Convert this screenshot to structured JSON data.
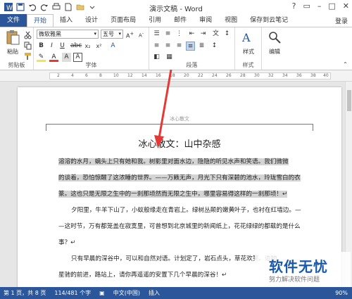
{
  "window": {
    "title": "演示文稿 - Word",
    "controls": [
      "?",
      "▭",
      "–",
      "□",
      "✕"
    ]
  },
  "tabs": {
    "file": "文件",
    "items": [
      "开始",
      "插入",
      "设计",
      "页面布局",
      "引用",
      "邮件",
      "审阅",
      "视图",
      "保存到云笔记"
    ],
    "login": "登录"
  },
  "ribbon": {
    "paste": "粘贴",
    "clipboard_label": "剪贴板",
    "font_name": "微软雅黑",
    "font_size": "五号",
    "font_label": "字体",
    "paragraph_label": "段落",
    "styles": "样式",
    "styles_label": "样式",
    "edit": "编辑"
  },
  "ruler": {
    "numbers": [
      "2",
      "4",
      "6",
      "8",
      "10",
      "12",
      "14",
      "16",
      "18",
      "20",
      "22",
      "24",
      "26",
      "28",
      "30",
      "32",
      "34",
      "36",
      "38",
      "40"
    ]
  },
  "document": {
    "header": "冰心散文",
    "title": "冰心散文：山中杂感",
    "paragraphs": [
      {
        "lines": [
          "溶溶的水月，螭头上只有她和我。树影里对面水边，隐隐的听见水声和笑语。我们微微",
          "的谈着，恐怕惊醒了这浓睡的世界。——万籁无声，月光下只有深碧的池水，玲珑雪白的衣",
          "篆。这也只是无限之生中的一刹那顷然而无限之生中，哪里容易得这样的一刹那顷！↵"
        ],
        "highlight": true
      },
      {
        "lines": [
          "夕阳里，牛羊下山了，小蚁般缘走在青岩上。绿树丛颠的嫩黄叶子，也衬在红墙边。—",
          "—这时节，万有都笼盖在寂寞里，可曾想到北京城里的新闻纸上，花花绿绿的都载的是什么",
          "事？↵"
        ],
        "highlight": false
      },
      {
        "lines": [
          "只有早晨的深谷中，可以和自然对语。计划定了，岩石点头，草花欢笑。造物",
          "星驰的前进，路站上，请你再遥遥的安置下几个早晨的深谷！↵"
        ],
        "highlight": false
      }
    ]
  },
  "status": {
    "page": "第 1 页，共 8 页",
    "words": "114/481 个字",
    "lang": "中文(中国)",
    "mode": "插入",
    "zoom": "90%"
  },
  "watermark": {
    "main": "软件无忧",
    "sub": "努力解决软件问题"
  },
  "colors": {
    "brand": "#2b579a",
    "arrow": "#e53935"
  }
}
